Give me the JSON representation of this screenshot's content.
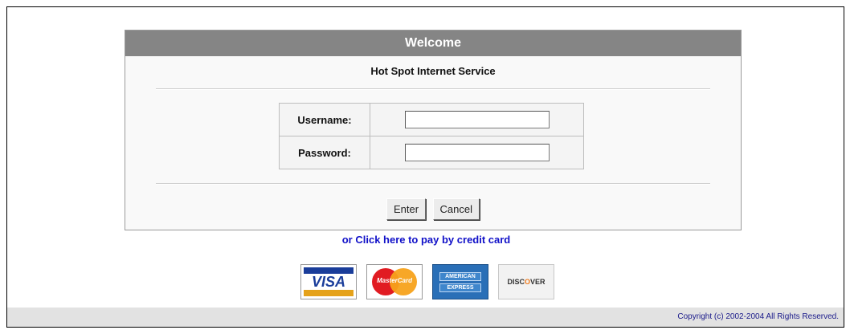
{
  "panel": {
    "header": "Welcome",
    "subtitle": "Hot Spot Internet Service"
  },
  "login": {
    "username_label": "Username:",
    "username_value": "",
    "password_label": "Password:",
    "password_value": ""
  },
  "buttons": {
    "enter_label": "Enter",
    "cancel_label": "Cancel"
  },
  "payment": {
    "link_text": "or Click here to pay by credit card",
    "cards": {
      "visa_text": "VISA",
      "mastercard_text": "MasterCard",
      "amex_line1": "AMERICAN",
      "amex_line2": "EXPRESS",
      "discover_prefix": "DISC",
      "discover_o": "O",
      "discover_suffix": "VER"
    }
  },
  "footer": {
    "copyright": "Copyright (c) 2002-2004 All Rights Reserved."
  },
  "colors": {
    "header_bg": "#858585",
    "link": "#1010c8",
    "footer_text": "#1a1a8a"
  }
}
